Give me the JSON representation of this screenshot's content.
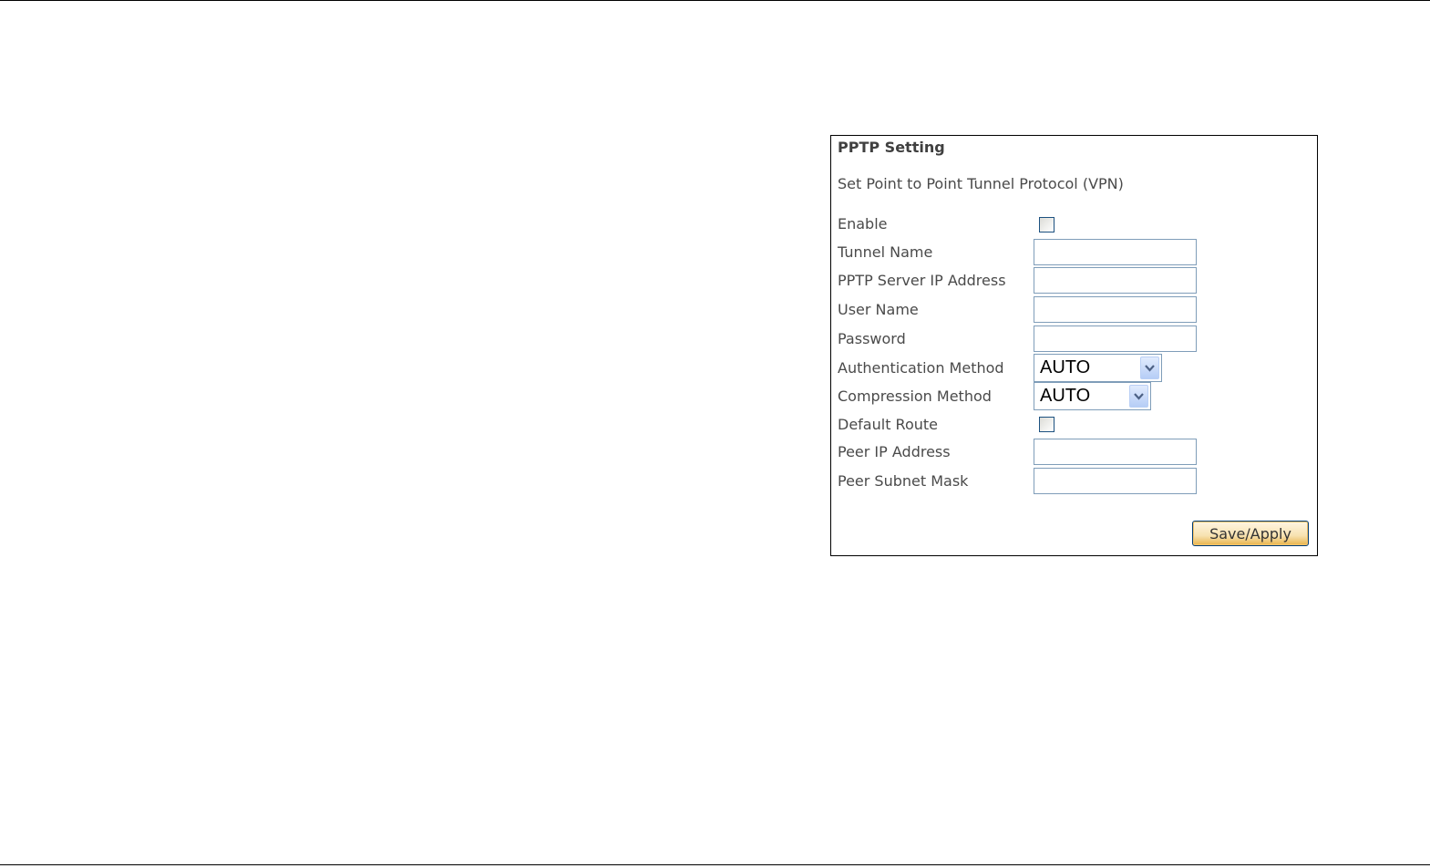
{
  "panel": {
    "title": "PPTP Setting",
    "subtitle": "Set Point to Point Tunnel Protocol (VPN)"
  },
  "fields": {
    "enable": {
      "label": "Enable",
      "checked": false
    },
    "tunnel_name": {
      "label": "Tunnel Name",
      "value": ""
    },
    "server_ip": {
      "label": "PPTP Server IP Address",
      "value": ""
    },
    "user_name": {
      "label": "User Name",
      "value": ""
    },
    "password": {
      "label": "Password",
      "value": ""
    },
    "auth_method": {
      "label": "Authentication Method",
      "selected": "AUTO"
    },
    "compression_method": {
      "label": "Compression Method",
      "selected": "AUTO"
    },
    "default_route": {
      "label": "Default Route",
      "checked": false
    },
    "peer_ip": {
      "label": "Peer IP Address",
      "value": ""
    },
    "peer_subnet": {
      "label": "Peer Subnet Mask",
      "value": ""
    }
  },
  "actions": {
    "save_label": "Save/Apply"
  },
  "icons": {
    "dropdown": "chevron-down-icon"
  },
  "colors": {
    "input_border": "#7f9db9",
    "checkbox_border": "#1c5180",
    "button_border": "#003c74",
    "button_accent": "#e8b34a"
  }
}
